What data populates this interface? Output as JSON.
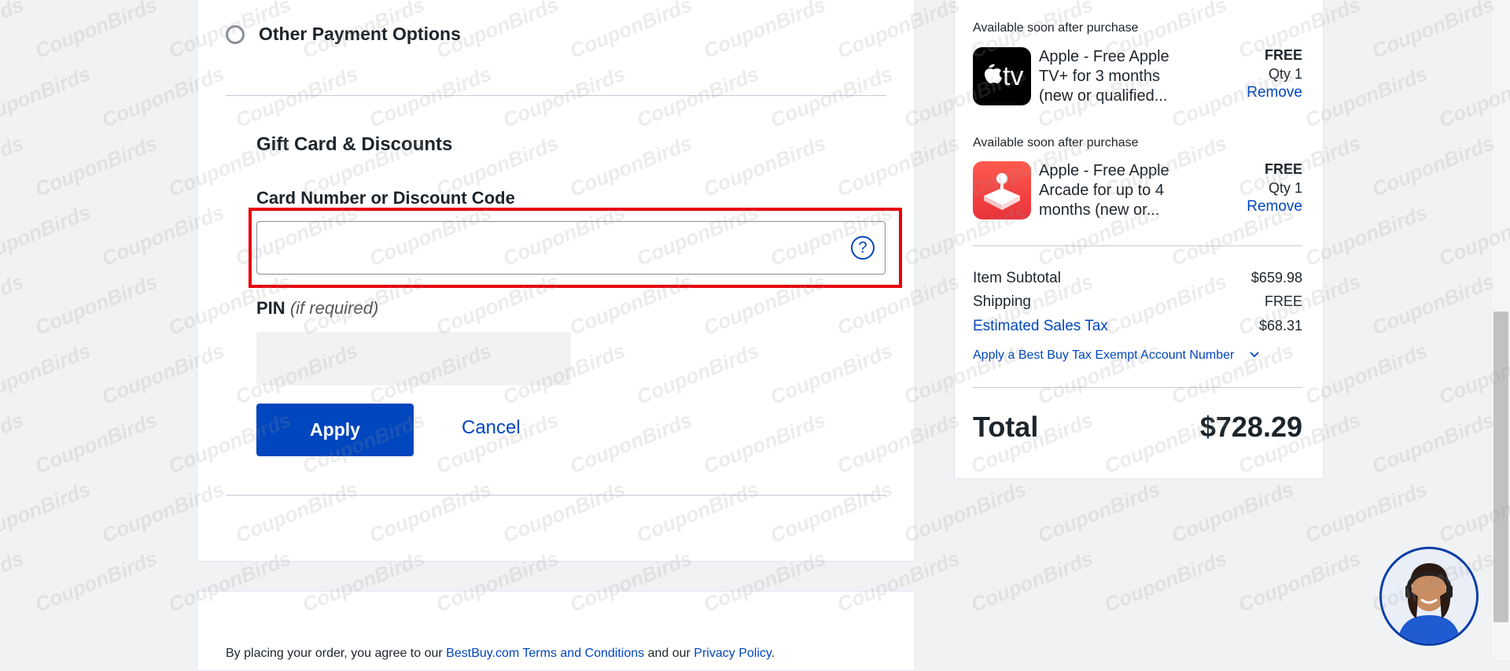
{
  "payment": {
    "other_options_label": "Other Payment Options"
  },
  "gift_card": {
    "title": "Gift Card & Discounts",
    "card_label": "Card Number or Discount Code",
    "card_value": "",
    "pin_label": "PIN",
    "pin_optional": "(if required)",
    "pin_value": "",
    "apply_label": "Apply",
    "cancel_label": "Cancel",
    "help_glyph": "?"
  },
  "legal": {
    "prefix": "By placing your order, you agree to our ",
    "terms_link": "BestBuy.com Terms and Conditions",
    "middle": " and our ",
    "privacy_link": "Privacy Policy",
    "suffix": "."
  },
  "order_summary": {
    "items": [
      {
        "availability": "Available soon after purchase",
        "icon": "apple-tv-icon",
        "tile_text": "tv",
        "name": "Apple - Free Apple TV+ for 3 months (new or qualified...",
        "price": "FREE",
        "qty": "Qty 1",
        "remove_label": "Remove"
      },
      {
        "availability": "Available soon after purchase",
        "icon": "apple-arcade-icon",
        "name": "Apple - Free Apple Arcade for up to 4 months (new or...",
        "price": "FREE",
        "qty": "Qty 1",
        "remove_label": "Remove"
      }
    ],
    "item_subtotal_label": "Item Subtotal",
    "item_subtotal_value": "$659.98",
    "shipping_label": "Shipping",
    "shipping_value": "FREE",
    "tax_label": "Estimated Sales Tax",
    "tax_value": "$68.31",
    "tax_exempt_label": "Apply a Best Buy Tax Exempt Account Number",
    "total_label": "Total",
    "total_value": "$728.29"
  },
  "watermark": "CouponBirds",
  "colors": {
    "accent": "#0046be",
    "highlight_border": "#e8000b",
    "text": "#1d252c",
    "background": "#f0f2f4"
  }
}
